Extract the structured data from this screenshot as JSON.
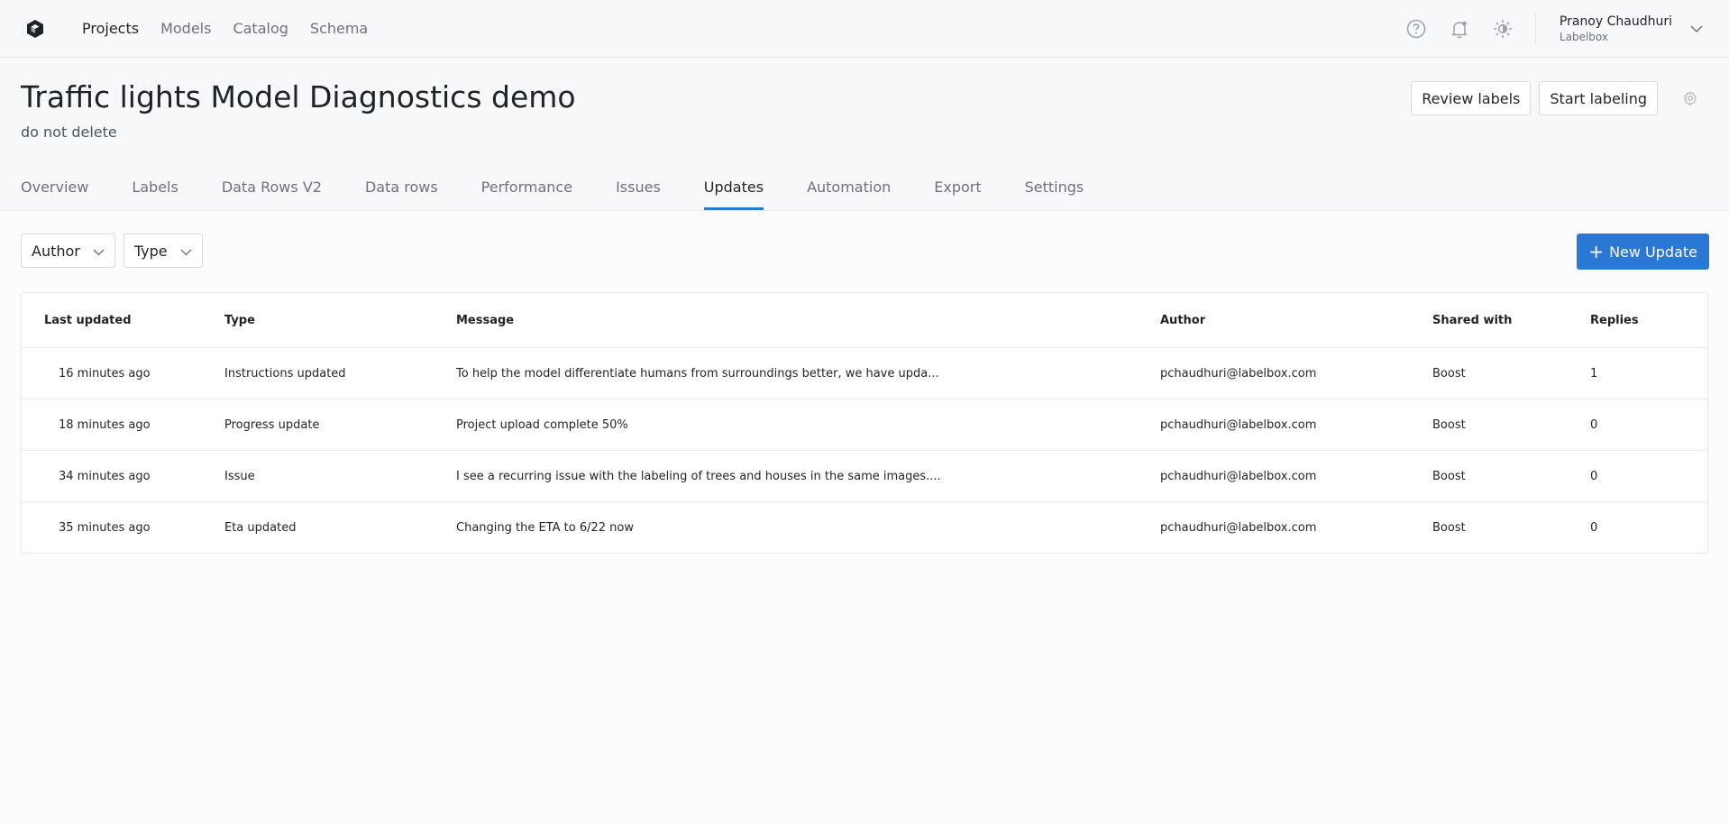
{
  "nav": {
    "items": [
      "Projects",
      "Models",
      "Catalog",
      "Schema"
    ],
    "active": "Projects"
  },
  "user": {
    "name": "Pranoy Chaudhuri",
    "org": "Labelbox"
  },
  "project": {
    "title": "Traffic lights Model Diagnostics demo",
    "subtitle": "do not delete",
    "review_label": "Review labels",
    "start_label": "Start labeling"
  },
  "tabs": [
    "Overview",
    "Labels",
    "Data Rows V2",
    "Data rows",
    "Performance",
    "Issues",
    "Updates",
    "Automation",
    "Export",
    "Settings"
  ],
  "active_tab": "Updates",
  "filters": {
    "author": "Author",
    "type": "Type"
  },
  "new_update_label": "New Update",
  "table": {
    "headers": [
      "Last updated",
      "Type",
      "Message",
      "Author",
      "Shared with",
      "Replies"
    ],
    "rows": [
      [
        "16 minutes ago",
        "Instructions updated",
        "To help the model differentiate humans from surroundings better, we have upda...",
        "pchaudhuri@labelbox.com",
        "Boost",
        "1"
      ],
      [
        "18 minutes ago",
        "Progress update",
        "Project upload complete 50%",
        "pchaudhuri@labelbox.com",
        "Boost",
        "0"
      ],
      [
        "34 minutes ago",
        "Issue",
        "I see a recurring issue with the labeling of trees and houses in the same images....",
        "pchaudhuri@labelbox.com",
        "Boost",
        "0"
      ],
      [
        "35 minutes ago",
        "Eta updated",
        "Changing the ETA to 6/22 now",
        "pchaudhuri@labelbox.com",
        "Boost",
        "0"
      ]
    ]
  },
  "colors": {
    "accent": "#2a77d4",
    "text": "#1f2328",
    "muted": "#6b7280"
  },
  "icons": [
    "labelbox-logo-icon",
    "help-icon",
    "notification-bell-icon",
    "theme-toggle-icon",
    "chevron-down-icon",
    "gear-icon",
    "plus-icon"
  ]
}
